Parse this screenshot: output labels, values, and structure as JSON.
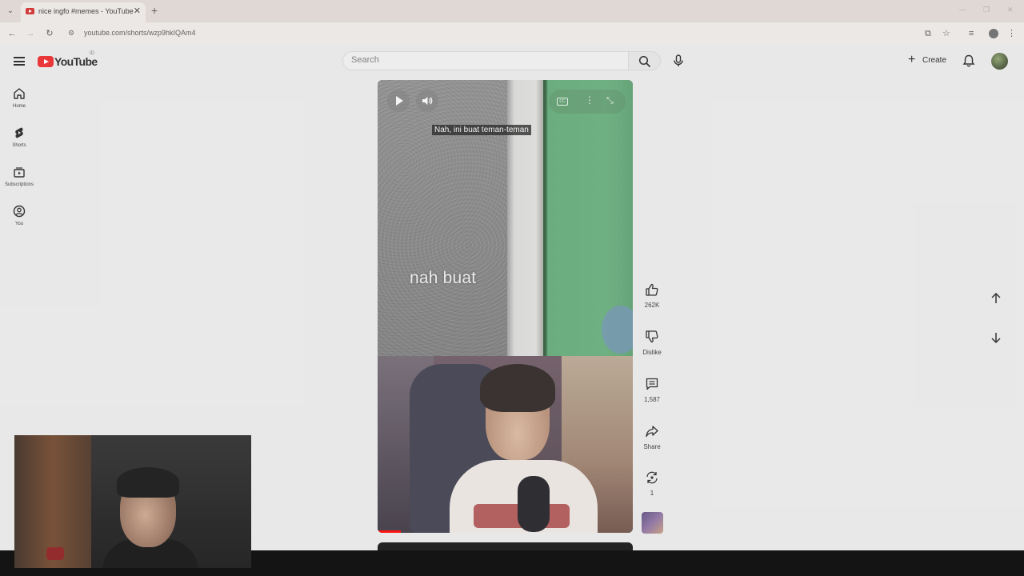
{
  "browser": {
    "tab_title": "nice ingfo #memes - YouTube",
    "url": "youtube.com/shorts/wzp9hkIQAm4"
  },
  "masthead": {
    "logo_text": "YouTube",
    "logo_country": "ID",
    "search_placeholder": "Search",
    "create_label": "Create"
  },
  "guide": {
    "items": [
      {
        "label": "Home",
        "icon": "home-icon"
      },
      {
        "label": "Shorts",
        "icon": "shorts-icon"
      },
      {
        "label": "Subscriptions",
        "icon": "subscriptions-icon"
      },
      {
        "label": "You",
        "icon": "you-icon"
      }
    ]
  },
  "player": {
    "caption": "Nah, ini buat teman-teman",
    "burned_text": "nah buat",
    "cc_label": "CC",
    "progress_fraction": 0.09
  },
  "actions": {
    "like_count": "262K",
    "dislike_label": "Dislike",
    "comment_count": "1,587",
    "share_label": "Share",
    "remix_count": "1"
  },
  "colors": {
    "youtube_red": "#e8262a",
    "progress_red": "#ff0000",
    "page_bg": "#e7e7e7"
  }
}
